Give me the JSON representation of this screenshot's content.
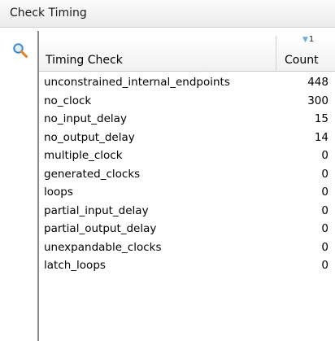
{
  "panel": {
    "title": "Check Timing"
  },
  "toolbar": {
    "search_icon": "search-icon"
  },
  "table": {
    "columns": [
      {
        "label": "Timing Check"
      },
      {
        "label": "Count",
        "sort_rank": "1",
        "sort_direction": "descending"
      }
    ],
    "rows": [
      {
        "check": "unconstrained_internal_endpoints",
        "count": "448"
      },
      {
        "check": "no_clock",
        "count": "300"
      },
      {
        "check": "no_input_delay",
        "count": "15"
      },
      {
        "check": "no_output_delay",
        "count": "14"
      },
      {
        "check": "multiple_clock",
        "count": "0"
      },
      {
        "check": "generated_clocks",
        "count": "0"
      },
      {
        "check": "loops",
        "count": "0"
      },
      {
        "check": "partial_input_delay",
        "count": "0"
      },
      {
        "check": "partial_output_delay",
        "count": "0"
      },
      {
        "check": "unexpandable_clocks",
        "count": "0"
      },
      {
        "check": "latch_loops",
        "count": "0"
      }
    ]
  },
  "colors": {
    "accent": "#6aaee0",
    "header_bg": "#ececec"
  }
}
